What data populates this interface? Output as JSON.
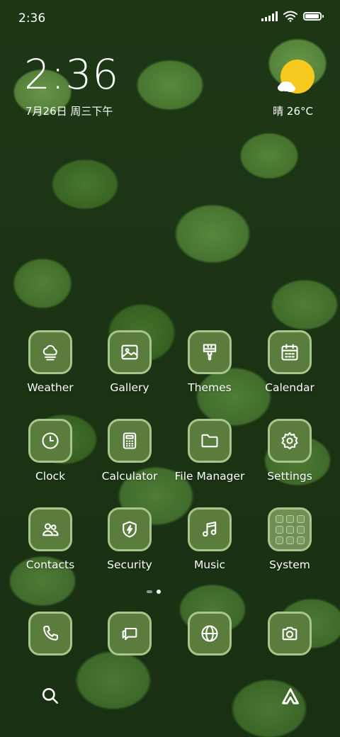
{
  "status_bar": {
    "time": "2:36",
    "battery_level": 0.95
  },
  "clock_widget": {
    "time": "2:36",
    "date": "7月26日 周三下午"
  },
  "weather_widget": {
    "condition_icon": "partly-sunny-icon",
    "text": "晴 26°C"
  },
  "apps": [
    {
      "label": "Weather",
      "icon": "weather-cloud-icon"
    },
    {
      "label": "Gallery",
      "icon": "image-icon"
    },
    {
      "label": "Themes",
      "icon": "paintbrush-icon"
    },
    {
      "label": "Calendar",
      "icon": "calendar-icon"
    },
    {
      "label": "Clock",
      "icon": "clock-icon"
    },
    {
      "label": "Calculator",
      "icon": "calculator-icon"
    },
    {
      "label": "File Manager",
      "icon": "folder-icon"
    },
    {
      "label": "Settings",
      "icon": "gear-icon"
    },
    {
      "label": "Contacts",
      "icon": "contacts-icon"
    },
    {
      "label": "Security",
      "icon": "shield-bolt-icon"
    },
    {
      "label": "Music",
      "icon": "music-note-icon"
    },
    {
      "label": "System",
      "icon": "folder-grid-icon"
    }
  ],
  "page_indicator": {
    "pages": 2,
    "current": 2
  },
  "dock": [
    {
      "icon": "phone-icon"
    },
    {
      "icon": "messages-icon"
    },
    {
      "icon": "browser-globe-icon"
    },
    {
      "icon": "camera-icon"
    }
  ],
  "bottom_bar": {
    "left_icon": "search-icon",
    "right_icon": "assistant-icon"
  },
  "theme": {
    "icon_fill": "#5a7d3d",
    "icon_border": "#a7c58c",
    "weather_sun": "#f7c81e"
  }
}
